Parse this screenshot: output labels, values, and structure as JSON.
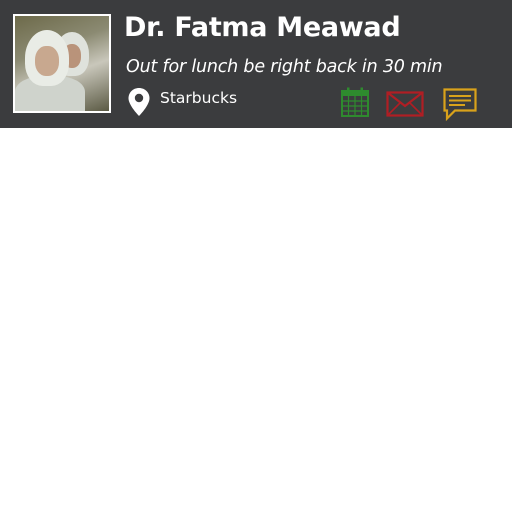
{
  "profile": {
    "name": "Dr. Fatma Meawad",
    "status": "Out for lunch be right back in 30 min",
    "location": "Starbucks"
  },
  "icons": {
    "avatar": "profile-photo",
    "location": "map-pin-icon",
    "calendar": "calendar-icon",
    "email": "envelope-icon",
    "message": "chat-bubble-icon"
  },
  "colors": {
    "card_background": "#3b3c3e",
    "calendar": "#2e8b2e",
    "email": "#b01e24",
    "message": "#d9a21b",
    "text": "#ffffff"
  }
}
